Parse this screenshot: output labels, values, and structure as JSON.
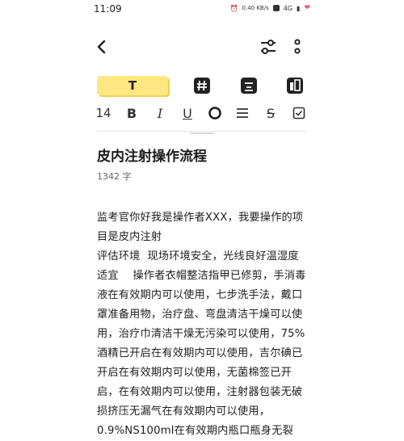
{
  "status_bar": {
    "time": "11:09",
    "speed": "0.40 KB/s",
    "network": "4G"
  },
  "toolbar": {
    "text_style_label": "T",
    "font_size": "14",
    "bold": "B",
    "italic": "I",
    "underline": "U",
    "strike": "S"
  },
  "note": {
    "title": "皮内注射操作流程",
    "char_count": "1342 字",
    "lines": [
      "监考官你好我是操作者XXX，我要操作的项",
      "目是皮内注射",
      "评估环境  现场环境安全，光线良好温湿度",
      "适宜    操作者衣帽整洁指甲已修剪，手消毒",
      "液在有效期内可以使用，七步洗手法，戴口",
      "罩准备用物，治疗盘、弯盘清洁干燥可以使",
      "用，治疗巾清洁干燥无污染可以使用，75%",
      "酒精已开启在有效期内可以使用，吉尔碘已",
      "开启在有效期内可以使用，无菌棉签已开",
      "启，在有效期内可以使用，注射器包装无破",
      "损挤压无漏气在有效期内可以使用，",
      "0.9%NS100ml在有效期内瓶口瓶身无裂"
    ]
  }
}
